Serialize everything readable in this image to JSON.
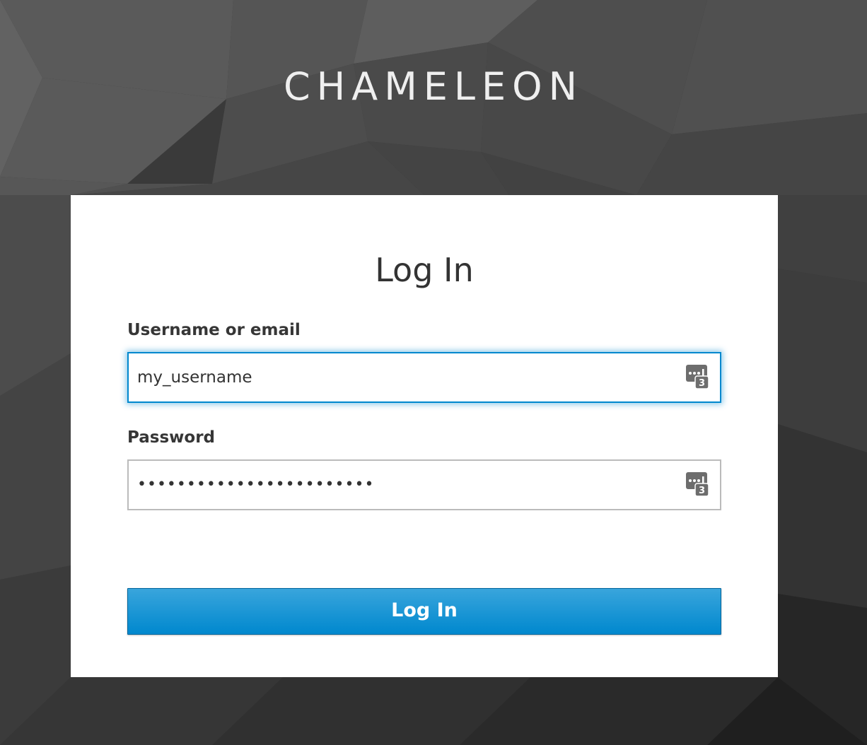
{
  "brand": {
    "title": "CHAMELEON"
  },
  "login": {
    "heading": "Log In",
    "username": {
      "label": "Username or email",
      "value": "my_username",
      "focused": true
    },
    "password": {
      "label": "Password",
      "value": "••••••••••••••••••••••••"
    },
    "password_manager_badge": "3",
    "submit_label": "Log In"
  },
  "colors": {
    "accent": "#0088ce",
    "button_top": "#39a5dc",
    "button_bottom": "#0088ce",
    "card_bg": "#ffffff",
    "page_bg": "#3a3a3a"
  },
  "icons": {
    "field_trailing": "password-manager-icon"
  }
}
